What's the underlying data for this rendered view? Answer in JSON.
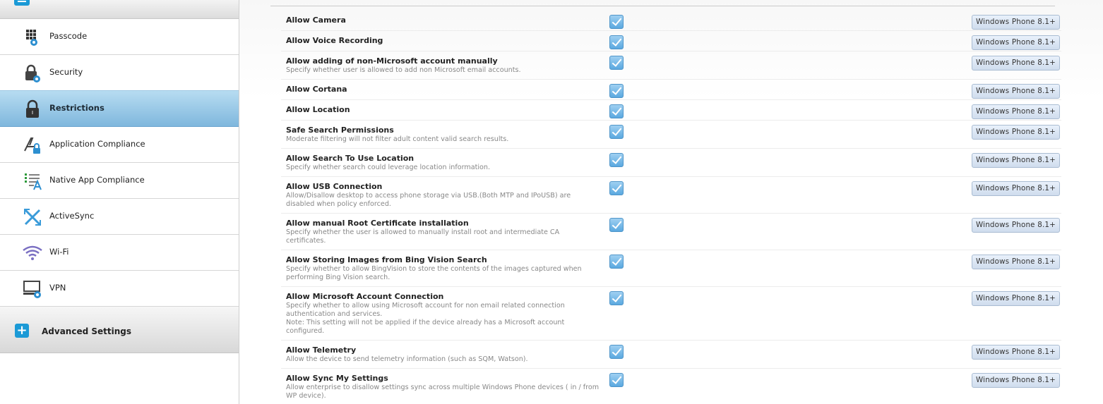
{
  "sidebar": {
    "items": [
      {
        "label": "Passcode",
        "icon": "passcode-icon"
      },
      {
        "label": "Security",
        "icon": "security-icon"
      },
      {
        "label": "Restrictions",
        "icon": "lock-icon",
        "active": true
      },
      {
        "label": "Application Compliance",
        "icon": "app-compliance-icon"
      },
      {
        "label": "Native App Compliance",
        "icon": "native-app-compliance-icon"
      },
      {
        "label": "ActiveSync",
        "icon": "activesync-icon"
      },
      {
        "label": "Wi-Fi",
        "icon": "wifi-icon"
      },
      {
        "label": "VPN",
        "icon": "vpn-icon"
      }
    ],
    "advanced_label": "Advanced Settings"
  },
  "colors": {
    "accent": "#1b9ad6",
    "active_bg": "#8fc1e3"
  },
  "restrictions": [
    {
      "title": "Allow Camera",
      "desc": "",
      "checked": true,
      "platform": "Windows Phone 8.1+"
    },
    {
      "title": "Allow Voice Recording",
      "desc": "",
      "checked": true,
      "platform": "Windows Phone 8.1+"
    },
    {
      "title": "Allow adding of non-Microsoft account manually",
      "desc": "Specify whether user is allowed to add non Microsoft email accounts.",
      "checked": true,
      "platform": "Windows Phone 8.1+"
    },
    {
      "title": "Allow Cortana",
      "desc": "",
      "checked": true,
      "platform": "Windows Phone 8.1+"
    },
    {
      "title": "Allow Location",
      "desc": "",
      "checked": true,
      "platform": "Windows Phone 8.1+"
    },
    {
      "title": "Safe Search Permissions",
      "desc": "Moderate filtering will not filter adult content valid search results.",
      "checked": true,
      "platform": "Windows Phone 8.1+"
    },
    {
      "title": "Allow Search To Use Location",
      "desc": "Specify whether search could leverage location information.",
      "checked": true,
      "platform": "Windows Phone 8.1+"
    },
    {
      "title": "Allow USB Connection",
      "desc": "Allow/Disallow desktop to access phone storage via USB.(Both MTP and IPoUSB) are disabled when policy enforced.",
      "checked": true,
      "platform": "Windows Phone 8.1+"
    },
    {
      "title": "Allow manual Root Certificate installation",
      "desc": "Specify whether the user is allowed to manually install root and intermediate CA certificates.",
      "checked": true,
      "platform": "Windows Phone 8.1+"
    },
    {
      "title": "Allow Storing Images from Bing Vision Search",
      "desc": "Specify whether to allow BingVision to store the contents of the images captured when performing Bing Vision search.",
      "checked": true,
      "platform": "Windows Phone 8.1+"
    },
    {
      "title": "Allow Microsoft Account Connection",
      "desc": "Specify whether to allow using Microsoft account for non email related connection authentication and services.",
      "note": "Note: This setting will not be applied if the device already has a Microsoft account configured.",
      "checked": true,
      "platform": "Windows Phone 8.1+"
    },
    {
      "title": "Allow Telemetry",
      "desc": "Allow the device to send telemetry information (such as SQM, Watson).",
      "checked": true,
      "platform": "Windows Phone 8.1+"
    },
    {
      "title": "Allow Sync My Settings",
      "desc": "Allow enterprise to disallow settings sync across multiple Windows Phone devices ( in / from WP device).",
      "checked": true,
      "platform": "Windows Phone 8.1+"
    }
  ]
}
